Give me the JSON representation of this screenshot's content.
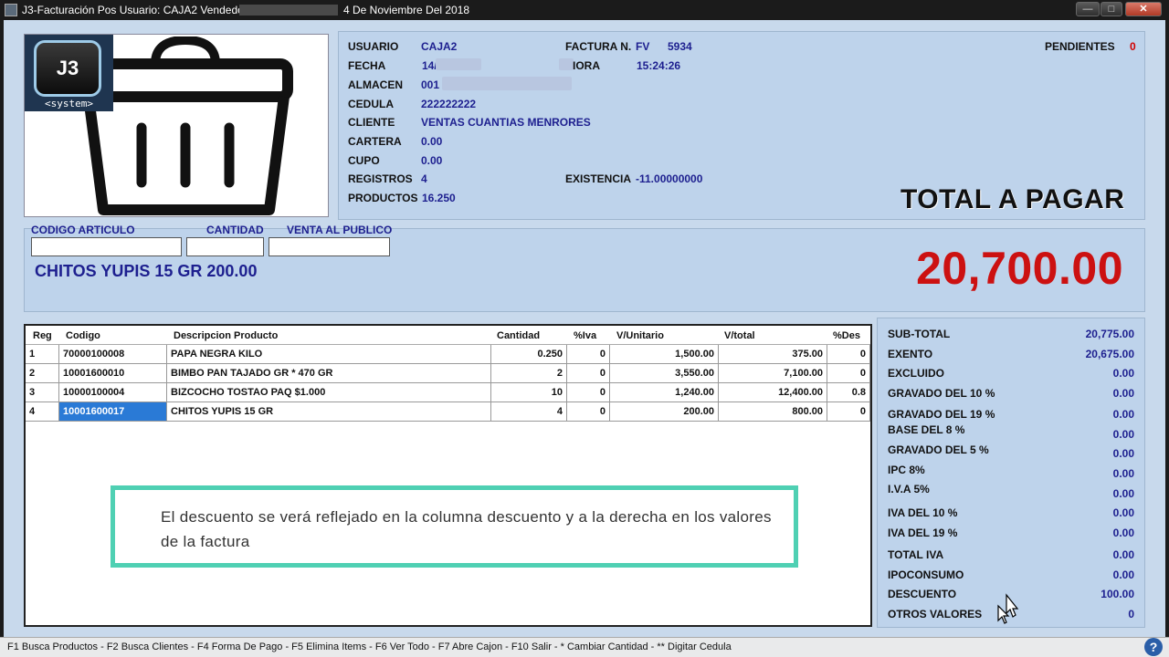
{
  "window": {
    "title": "J3-Facturación Pos Usuario: CAJA2 Vendedor: 0",
    "date": "4 De Noviembre Del 2018",
    "minimize_icon": "minimize-icon",
    "maximize_icon": "maximize-icon",
    "close_icon": "close-icon"
  },
  "logo": {
    "text": "J3",
    "subtext": "<system>"
  },
  "info": {
    "usuario_label": "USUARIO",
    "usuario": "CAJA2",
    "fecha_label": "FECHA",
    "fecha": "14/",
    "almacen_label": "ALMACEN",
    "almacen": "001",
    "cedula_label": "CEDULA",
    "cedula": "222222222",
    "cliente_label": "CLIENTE",
    "cliente": "VENTAS CUANTIAS MENRORES",
    "cartera_label": "CARTERA",
    "cartera": "0.00",
    "cupo_label": "CUPO",
    "cupo": "0.00",
    "registros_label": "REGISTROS",
    "registros": "4",
    "productos_label": "PRODUCTOS",
    "productos": "16.250",
    "factura_label": "FACTURA N.",
    "factura_prefix": "FV",
    "factura_num": "5934",
    "hora_label": "IORA",
    "hora": "15:24:26",
    "existencia_label": "EXISTENCIA",
    "existencia": "-11.00000000",
    "pendientes_label": "PENDIENTES",
    "pendientes": "0",
    "total_label": "TOTAL A PAGAR"
  },
  "entry": {
    "codigo_label": "CODIGO ARTICULO",
    "cantidad_label": "CANTIDAD",
    "venta_label": "VENTA AL PUBLICO",
    "codigo_value": "",
    "cantidad_value": "",
    "venta_value": "",
    "current_item": "CHITOS YUPIS 15 GR  200.00",
    "total": "20,700.00"
  },
  "grid": {
    "headers": [
      "Reg",
      "Codigo",
      "Descripcion Producto",
      "Cantidad",
      "%Iva",
      "V/Unitario",
      "V/total",
      "%Des"
    ],
    "rows": [
      {
        "reg": "1",
        "codigo": "70000100008",
        "desc": "PAPA NEGRA KILO",
        "cantidad": "0.250",
        "iva": "0",
        "unitario": "1,500.00",
        "total": "375.00",
        "des": "0"
      },
      {
        "reg": "2",
        "codigo": "10001600010",
        "desc": "BIMBO PAN TAJADO GR * 470 GR",
        "cantidad": "2",
        "iva": "0",
        "unitario": "3,550.00",
        "total": "7,100.00",
        "des": "0"
      },
      {
        "reg": "3",
        "codigo": "10000100004",
        "desc": "BIZCOCHO TOSTAO PAQ $1.000",
        "cantidad": "10",
        "iva": "0",
        "unitario": "1,240.00",
        "total": "12,400.00",
        "des": "0.8"
      },
      {
        "reg": "4",
        "codigo": "10001600017",
        "desc": "CHITOS YUPIS 15 GR",
        "cantidad": "4",
        "iva": "0",
        "unitario": "200.00",
        "total": "800.00",
        "des": "0"
      }
    ]
  },
  "callout": {
    "text": "El descuento se verá reflejado en la columna descuento y a la derecha en los valores de la factura"
  },
  "totals": [
    {
      "label": "SUB-TOTAL",
      "value": "20,775.00"
    },
    {
      "label": "EXENTO",
      "value": "20,675.00"
    },
    {
      "label": "EXCLUIDO",
      "value": "0.00"
    },
    {
      "label": "GRAVADO DEL 10 %",
      "value": "0.00"
    },
    {
      "label": "GRAVADO DEL 19 %",
      "value": "0.00"
    },
    {
      "label": "BASE DEL 8 %",
      "value": "0.00"
    },
    {
      "label": "GRAVADO DEL 5 %",
      "value": "0.00"
    },
    {
      "label": "IPC 8%",
      "value": "0.00"
    },
    {
      "label": "I.V.A 5%",
      "value": "0.00"
    },
    {
      "label": "IVA DEL 10 %",
      "value": "0.00"
    },
    {
      "label": "IVA DEL 19 %",
      "value": "0.00"
    },
    {
      "label": "TOTAL IVA",
      "value": "0.00"
    },
    {
      "label": "IPOCONSUMO",
      "value": "0.00"
    },
    {
      "label": "DESCUENTO",
      "value": "100.00"
    },
    {
      "label": "OTROS VALORES",
      "value": "0"
    }
  ],
  "statusbar": {
    "text": "F1 Busca Productos - F2 Busca Clientes - F4 Forma De Pago - F5 Elimina Items - F6 Ver Todo - F7 Abre Cajon - F10 Salir - * Cambiar Cantidad - ** Digitar Cedula",
    "help": "?"
  }
}
